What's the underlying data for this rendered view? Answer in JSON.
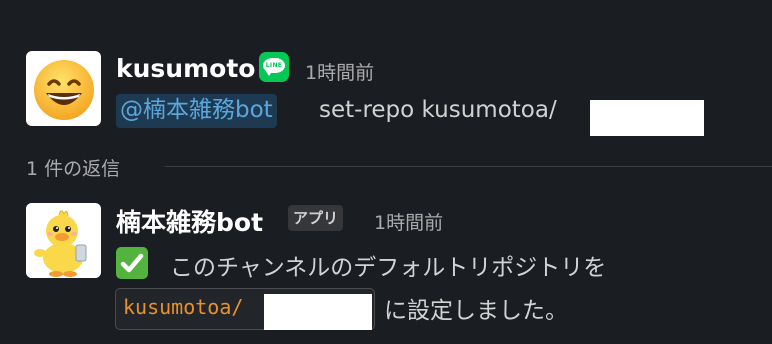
{
  "message1": {
    "username": "kusumoto",
    "service_badge": "LINE",
    "timestamp": "1時間前",
    "mention": "@楠本雑務bot",
    "text": "set-repo kusumotoa/",
    "avatar_icon": "grinning-face-emoji"
  },
  "thread": {
    "reply_count": "1 件の返信"
  },
  "message2": {
    "username": "楠本雑務bot",
    "app_badge": "アプリ",
    "timestamp": "1時間前",
    "line1": "このチャンネルのデフォルトリポジトリを",
    "code": "kusumotoa/",
    "line2_suffix": "に設定しました。",
    "status_icon": "white-check-mark",
    "avatar_icon": "duck-mascot"
  }
}
